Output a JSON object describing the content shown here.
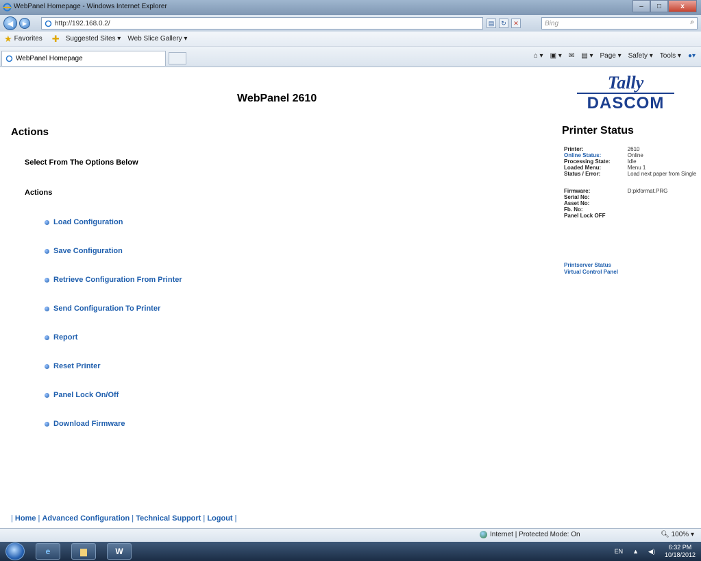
{
  "window": {
    "title": "WebPanel Homepage - Windows Internet Explorer",
    "min": "–",
    "max": "□",
    "close": "x"
  },
  "address": {
    "url": "http://192.168.0.2/",
    "search_placeholder": "Bing"
  },
  "favorites": {
    "label": "Favorites",
    "suggested": "Suggested Sites ▾",
    "webslice": "Web Slice Gallery ▾"
  },
  "tab": {
    "label": "WebPanel Homepage"
  },
  "commands": [
    "Page ▾",
    "Safety ▾",
    "Tools ▾"
  ],
  "page": {
    "title": "WebPanel 2610",
    "logo_top": "Tally",
    "logo_bottom": "DASCOM",
    "actions_heading": "Actions",
    "subtitle": "Select From The Options Below",
    "actions_label": "Actions",
    "menu": [
      "Load Configuration",
      "Save Configuration",
      "Retrieve Configuration From Printer",
      "Send Configuration To Printer",
      "Report",
      "Reset Printer",
      "Panel Lock On/Off",
      "Download Firmware"
    ]
  },
  "status": {
    "title": "Printer Status",
    "rows": [
      {
        "k": "Printer:",
        "v": "2610"
      },
      {
        "k": "Online Status:",
        "v": "Online"
      },
      {
        "k": "Processing State:",
        "v": "Idle"
      },
      {
        "k": "Loaded Menu:",
        "v": "Menu 1"
      },
      {
        "k": "Status / Error:",
        "v": "Load next paper from Single"
      }
    ],
    "rows2": [
      {
        "k": "Firmware:",
        "v": "D:pkformat.PRG"
      },
      {
        "k": "Serial No:",
        "v": ""
      },
      {
        "k": "Asset No:",
        "v": ""
      },
      {
        "k": "Fb. No:",
        "v": ""
      },
      {
        "k": "Panel Lock OFF",
        "v": ""
      }
    ],
    "links": [
      "Printserver Status",
      "Virtual Control Panel"
    ]
  },
  "footer": {
    "home": "Home",
    "advanced": "Advanced Configuration",
    "support": "Technical Support",
    "logout": "Logout"
  },
  "statusbar": {
    "zone": "Internet | Protected Mode: On",
    "zoom": "100%"
  },
  "taskbar": {
    "lang": "EN",
    "time": "6:32 PM",
    "date": "10/18/2012",
    "word": "W"
  }
}
